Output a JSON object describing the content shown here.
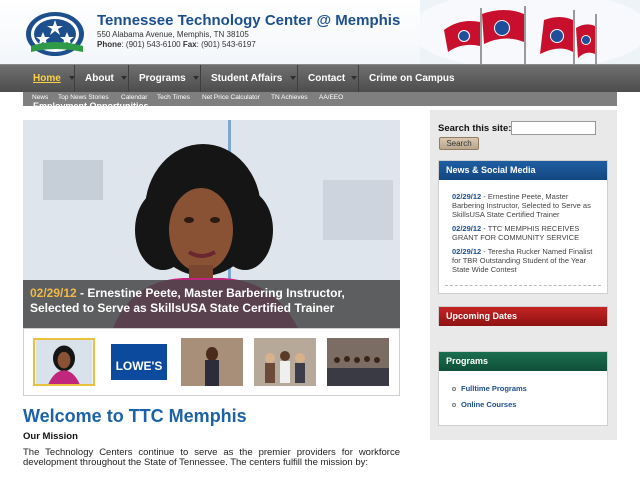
{
  "header": {
    "title": "Tennessee Technology Center @ Memphis",
    "address": "550 Alabama Avenue, Memphis, TN 38105",
    "phone_label": "Phone",
    "phone": ": (901) 543-6100 ",
    "fax_label": "Fax",
    "fax": ": (901) 543-6197"
  },
  "nav": {
    "items": [
      {
        "label": "Home",
        "active": true
      },
      {
        "label": "About"
      },
      {
        "label": "Programs"
      },
      {
        "label": "Student Affairs"
      },
      {
        "label": "Contact"
      },
      {
        "label": "Crime on Campus"
      }
    ]
  },
  "subnav": {
    "items": [
      "News",
      "Top News Stories",
      "Calendar",
      "Tech Times",
      "Net Price Calculator",
      "TN Achieves",
      "AA/EEO"
    ],
    "overflow": "Employment Opportunities"
  },
  "slideshow": {
    "caption_date": "02/29/12",
    "caption_text": " - Ernestine Peete, Master Barbering Instructor, Selected to Serve as SkillsUSA State Certified Trainer",
    "thumb_lowes_text": "LOWE'S"
  },
  "main": {
    "welcome": "Welcome to TTC Memphis",
    "mission_heading": "Our Mission",
    "mission_text": "The Technology Centers continue to serve as the premier providers for workforce development throughout the State of Tennessee. The centers fulfill the mission by:"
  },
  "sidebar": {
    "search_label": "Search this site:",
    "search_button": "Search",
    "news_title": "News & Social Media",
    "news": [
      {
        "date": "02/29/12",
        "text": " - Ernestine Peete, Master Barbering Instructor, Selected to Serve as SkillsUSA State Certified Trainer"
      },
      {
        "date": "02/29/12",
        "text": " - TTC MEMPHIS RECEIVES GRANT FOR COMMUNITY SERVICE"
      },
      {
        "date": "02/29/12",
        "text": " - Teresha Rucker Named Finalist for TBR Outstanding Student of the Year State Wide Contest"
      }
    ],
    "dates_title": "Upcoming Dates",
    "programs_title": "Programs",
    "programs": [
      "Fulltime Programs",
      "Online Courses"
    ]
  },
  "colors": {
    "brand_blue": "#1c4f8c",
    "nav_active": "#f7d24a",
    "caption_date": "#f0b94a",
    "widget_blue": "#1f5ea3",
    "widget_red": "#c52525",
    "widget_green": "#1b6e50"
  }
}
